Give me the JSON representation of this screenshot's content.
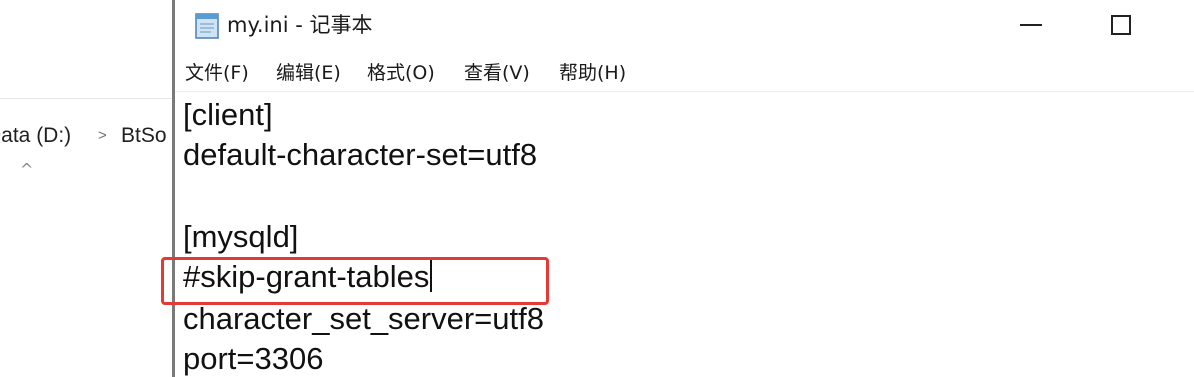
{
  "explorer": {
    "address_segment_1": "Data (D:)",
    "address_separator": ">",
    "address_segment_2": "BtSo",
    "up_caret": "^"
  },
  "notepad": {
    "title": "my.ini - 记事本",
    "menu": [
      "文件(F)",
      "编辑(E)",
      "格式(O)",
      "查看(V)",
      "帮助(H)"
    ],
    "lines": [
      "[client]",
      "default-character-set=utf8",
      "",
      "[mysqld]",
      "#skip-grant-tables",
      "character_set_server=utf8",
      "port=3306"
    ],
    "highlighted_line_index": 4
  },
  "colors": {
    "highlight": "#e53935",
    "text": "#111111",
    "window_edge": "#7a7a7a"
  },
  "icons": {
    "app": "notepad-icon",
    "minimize": "minimize-icon",
    "maximize": "maximize-icon",
    "separator": "chevron-right-icon",
    "up": "chevron-up-icon"
  }
}
